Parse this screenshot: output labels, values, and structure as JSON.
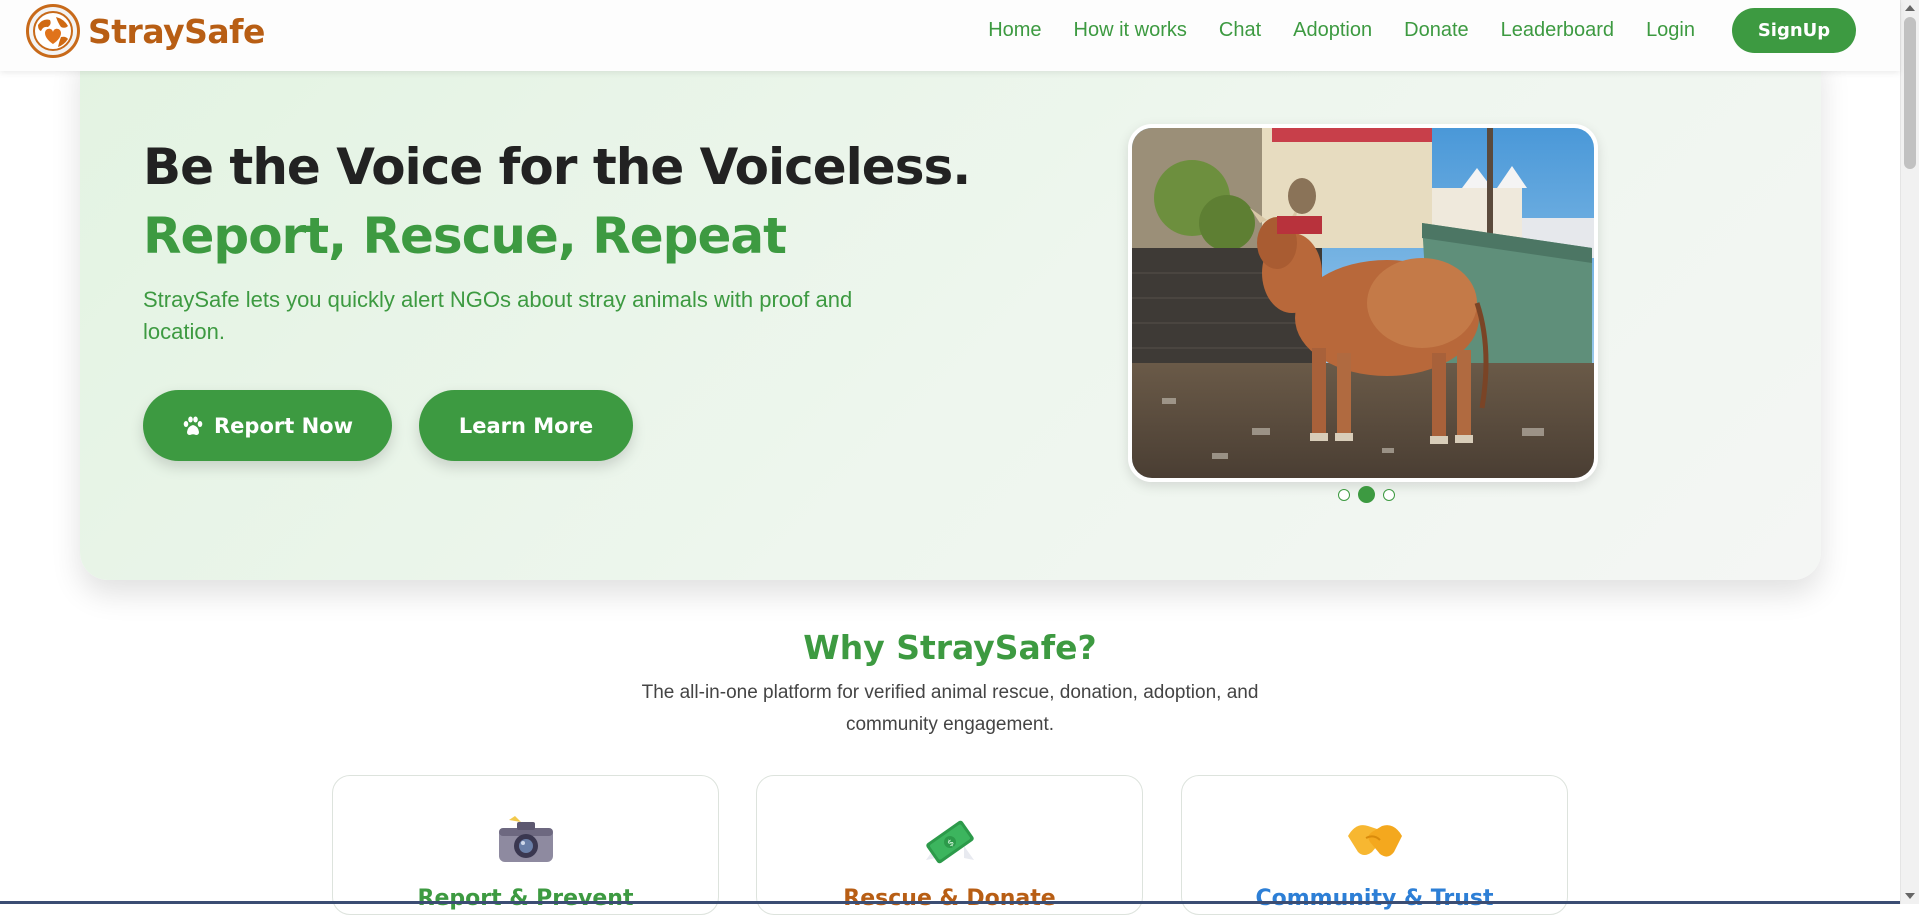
{
  "brand": {
    "name": "StraySafe",
    "logo_icon": "globe-heart-logo-icon"
  },
  "nav": {
    "links": [
      "Home",
      "How it works",
      "Chat",
      "Adoption",
      "Donate",
      "Leaderboard",
      "Login"
    ],
    "signup_label": "SignUp"
  },
  "hero": {
    "title": "Be the Voice for the Voiceless.",
    "tagline": "Report, Rescue, Repeat",
    "description": "StraySafe lets you quickly alert NGOs about stray animals with proof and location.",
    "report_button": "Report Now",
    "report_icon": "paw-icon",
    "learn_button": "Learn More",
    "carousel": {
      "slide_count": 3,
      "active_slide": 2,
      "image_subject": "cow-in-street-photo"
    }
  },
  "why": {
    "title": "Why StraySafe?",
    "subtitle": "The all-in-one platform for verified animal rescue, donation, adoption, and community engagement.",
    "cards": [
      {
        "icon": "camera-icon",
        "title": "Report & Prevent",
        "color": "#3d9a41"
      },
      {
        "icon": "money-icon",
        "title": "Rescue & Donate",
        "color": "#b85e14"
      },
      {
        "icon": "handshake-icon",
        "title": "Community & Trust",
        "color": "#2d7fd6"
      }
    ]
  },
  "colors": {
    "brand_orange": "#b85e14",
    "accent_green": "#3d9a41",
    "card_blue": "#2d7fd6"
  }
}
